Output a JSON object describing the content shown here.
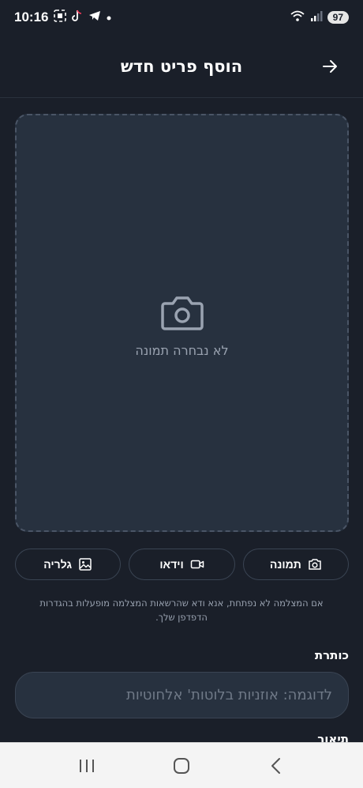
{
  "status_bar": {
    "time": "10:16",
    "battery": "97",
    "icons": [
      "screenshot-icon",
      "tiktok-icon",
      "telegram-icon",
      "dot-icon",
      "wifi-icon",
      "signal-icon"
    ]
  },
  "header": {
    "title": "הוסף פריט חדש",
    "back_icon": "arrow-right-icon"
  },
  "upload": {
    "empty_text": "לא נבחרה תמונה",
    "icon": "camera-icon"
  },
  "media_buttons": [
    {
      "label": "תמונה",
      "icon": "camera-icon"
    },
    {
      "label": "וידאו",
      "icon": "video-icon"
    },
    {
      "label": "גלריה",
      "icon": "image-icon"
    }
  ],
  "hint": "אם המצלמה לא נפתחת, אנא ודא שהרשאות המצלמה מופעלות בהגדרות הדפדפן שלך.",
  "form": {
    "title_label": "כותרת",
    "title_placeholder": "לדוגמה: אוזניות בלוטות' אלחוטיות",
    "title_value": "",
    "next_label": "תיאור"
  },
  "nav_bar": {
    "icons": [
      "recent-apps-icon",
      "home-icon",
      "back-icon"
    ]
  },
  "colors": {
    "background": "#1a1f29",
    "card": "#27313f",
    "border": "#3a4453",
    "muted_text": "#9aa3b1",
    "nav_bar": "#f4f4f4"
  }
}
